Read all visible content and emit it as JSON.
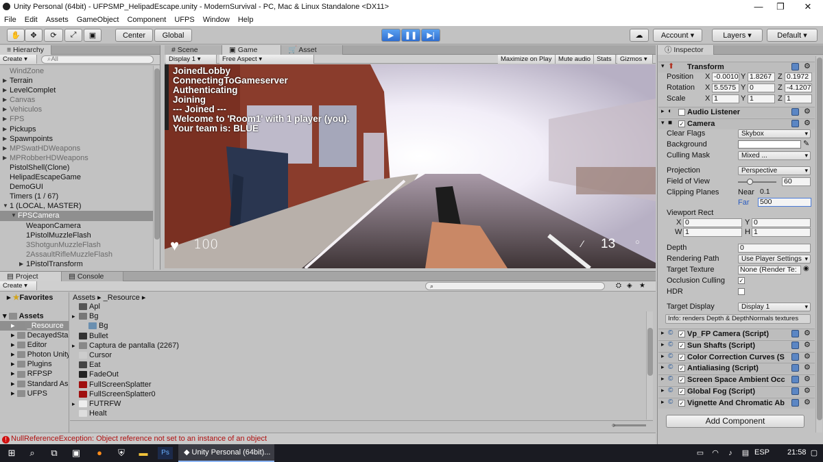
{
  "window": {
    "title": "Unity Personal (64bit) - UFPSMP_HelipadEscape.unity - ModernSurvival - PC, Mac & Linux Standalone <DX11>"
  },
  "menu": [
    "File",
    "Edit",
    "Assets",
    "GameObject",
    "Component",
    "UFPS",
    "Window",
    "Help"
  ],
  "toolbar": {
    "center": "Center",
    "global": "Global",
    "account": "Account",
    "layers": "Layers",
    "layout": "Default"
  },
  "hierarchy": {
    "tab": "Hierarchy",
    "create": "Create",
    "search": "All",
    "items": [
      {
        "label": "WindZone",
        "grey": true,
        "arrow": false,
        "indent": 0
      },
      {
        "label": "Terrain",
        "arrow": true,
        "indent": 0
      },
      {
        "label": "LevelComplet",
        "arrow": true,
        "indent": 0
      },
      {
        "label": "Canvas",
        "grey": true,
        "arrow": true,
        "indent": 0
      },
      {
        "label": "Vehiculos",
        "grey": true,
        "arrow": true,
        "indent": 0
      },
      {
        "label": "FPS",
        "grey": true,
        "arrow": true,
        "indent": 0
      },
      {
        "label": "Pickups",
        "arrow": true,
        "indent": 0
      },
      {
        "label": "Spawnpoints",
        "arrow": true,
        "indent": 0
      },
      {
        "label": "MPSwatHDWeapons",
        "grey": true,
        "arrow": true,
        "indent": 0
      },
      {
        "label": "MPRobberHDWeapons",
        "grey": true,
        "arrow": true,
        "indent": 0
      },
      {
        "label": "PistolShell(Clone)",
        "arrow": false,
        "indent": 0
      },
      {
        "label": "HelipadEscapeGame",
        "arrow": false,
        "indent": 0
      },
      {
        "label": "DemoGUI",
        "arrow": false,
        "indent": 0
      },
      {
        "label": "Timers (1 / 67)",
        "arrow": false,
        "indent": 0
      },
      {
        "label": "1 (LOCAL, MASTER)",
        "arrow": true,
        "open": true,
        "indent": 0
      },
      {
        "label": "FPSCamera",
        "sel": true,
        "arrow": true,
        "open": true,
        "indent": 1
      },
      {
        "label": "WeaponCamera",
        "arrow": false,
        "indent": 2
      },
      {
        "label": "1PistolMuzzleFlash",
        "arrow": false,
        "indent": 2
      },
      {
        "label": "3ShotgunMuzzleFlash",
        "grey": true,
        "arrow": false,
        "indent": 2
      },
      {
        "label": "2AssaultRifleMuzzleFlash",
        "grey": true,
        "arrow": false,
        "indent": 2
      },
      {
        "label": "1PistolTransform",
        "arrow": true,
        "indent": 2
      }
    ]
  },
  "scene_tabs": {
    "scene": "Scene",
    "game": "Game",
    "asset_store": "Asset Store"
  },
  "game": {
    "display": "Display 1",
    "aspect": "Free Aspect",
    "maximize": "Maximize on Play",
    "mute": "Mute audio",
    "stats": "Stats",
    "gizmos": "Gizmos",
    "log": [
      "JoinedLobby",
      "ConnectingToGameserver",
      "Authenticating",
      "Joining",
      "--- Joined ---",
      "Welcome to 'Room1' with 1 player (you).",
      "Your team is: BLUE"
    ],
    "health": "100",
    "ammo": "13"
  },
  "project": {
    "tab": "Project",
    "console_tab": "Console",
    "create": "Create",
    "favorites": "Favorites",
    "assets": "Assets",
    "tree": [
      "_Resource",
      "DecayedSta",
      "Editor",
      "Photon Unity",
      "Plugins",
      "RFPSP",
      "Standard As",
      "UFPS"
    ],
    "breadcrumb": [
      "Assets",
      "_Resource"
    ],
    "files": [
      {
        "label": "Apl",
        "icon": "#555",
        "arrow": false,
        "indent": 0
      },
      {
        "label": "Bg",
        "icon": "#777",
        "arrow": true,
        "indent": 0
      },
      {
        "label": "Bg",
        "icon": "#6a8fb0",
        "arrow": false,
        "indent": 1
      },
      {
        "label": "Bullet",
        "icon": "#333",
        "arrow": false,
        "indent": 0
      },
      {
        "label": "Captura de pantalla (2267)",
        "icon": "#888",
        "arrow": true,
        "indent": 0
      },
      {
        "label": "Cursor",
        "icon": "#ccc",
        "arrow": false,
        "indent": 0
      },
      {
        "label": "Eat",
        "icon": "#444",
        "arrow": false,
        "indent": 0
      },
      {
        "label": "FadeOut",
        "icon": "#222",
        "arrow": false,
        "indent": 0
      },
      {
        "label": "FullScreenSplatter",
        "icon": "#a01010",
        "arrow": false,
        "indent": 0
      },
      {
        "label": "FullScreenSplatter0",
        "icon": "#a01010",
        "arrow": false,
        "indent": 0
      },
      {
        "label": "FUTRFW",
        "icon": "#eee",
        "arrow": true,
        "indent": 0
      },
      {
        "label": "Healt",
        "icon": "#ddd",
        "arrow": false,
        "indent": 0
      }
    ]
  },
  "inspector": {
    "tab": "Inspector",
    "transform": "Transform",
    "position": {
      "label": "Position",
      "x": "-0.0010",
      "y": "1.8267",
      "z": "0.1972"
    },
    "rotation": {
      "label": "Rotation",
      "x": "5.5575",
      "y": "0",
      "z": "-4.1207"
    },
    "scale": {
      "label": "Scale",
      "x": "1",
      "y": "1",
      "z": "1"
    },
    "audio_listener": "Audio Listener",
    "camera": "Camera",
    "clear_flags": {
      "label": "Clear Flags",
      "value": "Skybox"
    },
    "background": {
      "label": "Background",
      "color": "#ffffff"
    },
    "culling_mask": {
      "label": "Culling Mask",
      "value": "Mixed ..."
    },
    "projection": {
      "label": "Projection",
      "value": "Perspective"
    },
    "fov": {
      "label": "Field of View",
      "value": "60",
      "slider_fraction": 0.3
    },
    "clipping": {
      "label": "Clipping Planes",
      "near_label": "Near",
      "near": "0.1",
      "far_label": "Far",
      "far": "500"
    },
    "viewport": {
      "label": "Viewport Rect",
      "x": "0",
      "y": "0",
      "w": "1",
      "h": "1"
    },
    "depth": {
      "label": "Depth",
      "value": "0"
    },
    "rendering_path": {
      "label": "Rendering Path",
      "value": "Use Player Settings"
    },
    "target_texture": {
      "label": "Target Texture",
      "value": "None (Render Te:"
    },
    "occlusion": {
      "label": "Occlusion Culling"
    },
    "hdr": {
      "label": "HDR"
    },
    "target_display": {
      "label": "Target Display",
      "value": "Display 1"
    },
    "info": "Info: renders Depth & DepthNormals textures",
    "scripts": [
      "Vp_FP Camera (Script)",
      "Sun Shafts (Script)",
      "Color Correction Curves (S",
      "Antialiasing (Script)",
      "Screen Space Ambient Occ",
      "Global Fog (Script)",
      "Vignette And Chromatic Ab"
    ],
    "add_component": "Add Component"
  },
  "status": {
    "error": "NullReferenceException: Object reference not set to an instance of an object"
  },
  "taskbar": {
    "app": "Unity Personal (64bit)...",
    "lang": "ESP",
    "time": "21:58"
  }
}
